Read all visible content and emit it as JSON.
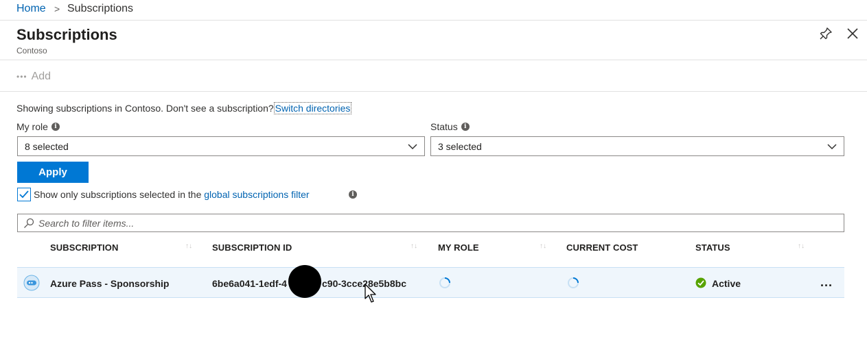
{
  "breadcrumb": {
    "home": "Home",
    "separator": ">",
    "current": "Subscriptions"
  },
  "header": {
    "title": "Subscriptions",
    "subtitle": "Contoso",
    "pin_icon": "pin-icon",
    "close_icon": "close-icon"
  },
  "command_bar": {
    "add_label": "Add",
    "add_icon": "more-dots-icon"
  },
  "info": {
    "text": "Showing subscriptions in Contoso. Don't see a subscription?",
    "link": "Switch directories"
  },
  "filters": {
    "role_label": "My role",
    "role_value": "8 selected",
    "status_label": "Status",
    "status_value": "3 selected",
    "apply_label": "Apply",
    "checkbox_checked": true,
    "checkbox_text": "Show only subscriptions selected in the",
    "checkbox_link": "global subscriptions filter"
  },
  "search": {
    "placeholder": "Search to filter items..."
  },
  "table": {
    "columns": [
      "SUBSCRIPTION",
      "SUBSCRIPTION ID",
      "MY ROLE",
      "CURRENT COST",
      "STATUS"
    ],
    "rows": [
      {
        "subscription": "Azure Pass - Sponsorship",
        "subscription_id_start": "6be6a041-1edf-4",
        "subscription_id_end": "c90-3cce28e5b8bc",
        "my_role": "loading",
        "current_cost": "loading",
        "status": "Active",
        "more": "..."
      }
    ]
  },
  "colors": {
    "accent": "#0078d4",
    "link": "#0063b1",
    "row_selected": "#eff6fc",
    "status_active": "#57a300"
  }
}
